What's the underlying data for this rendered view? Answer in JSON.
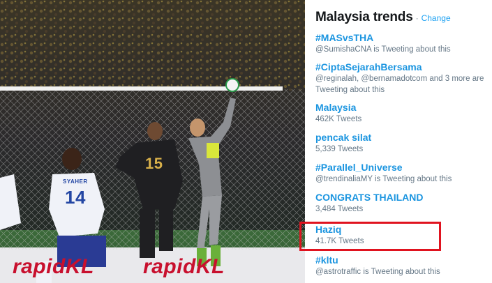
{
  "photo": {
    "ad_text_left": "rapidKL",
    "ad_text_right": "rapidKL",
    "jersey_number_dark": "15",
    "jersey_number_white": "14",
    "jersey_name_white": "SYAHER"
  },
  "trends_panel": {
    "title": "Malaysia trends",
    "separator": "·",
    "change_label": "Change",
    "items": [
      {
        "name": "#MASvsTHA",
        "meta": "@SumishaCNA is Tweeting about this"
      },
      {
        "name": "#CiptaSejarahBersama",
        "meta": "@reginalah, @bernamadotcom and 3 more are Tweeting about this"
      },
      {
        "name": "Malaysia",
        "meta": "462K Tweets"
      },
      {
        "name": "pencak silat",
        "meta": "5,339 Tweets"
      },
      {
        "name": "#Parallel_Universe",
        "meta": "@trendinaliaMY is Tweeting about this"
      },
      {
        "name": "CONGRATS THAILAND",
        "meta": "3,484 Tweets"
      },
      {
        "name": "Haziq",
        "meta": "41.7K Tweets"
      },
      {
        "name": "#kltu",
        "meta": "@astrotraffic is Tweeting about this"
      }
    ]
  },
  "colors": {
    "trend_link": "#1b95e0",
    "highlight": "#e0131f",
    "meta_text": "#657786"
  }
}
